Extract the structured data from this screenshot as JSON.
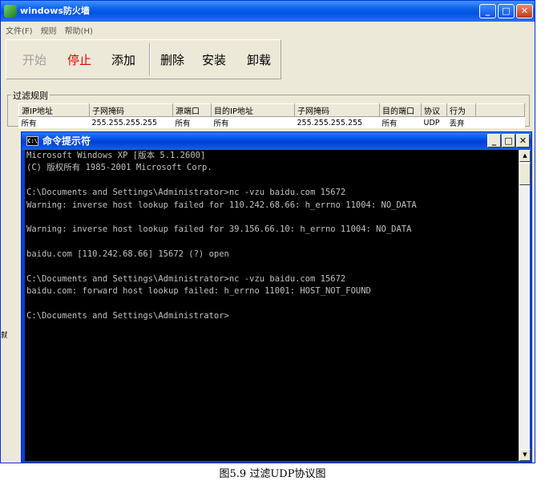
{
  "fw_window": {
    "title": "windows防火墙",
    "menu": [
      "文件(F)",
      "规则",
      "帮助(H)"
    ],
    "toolbar": {
      "start": "开始",
      "stop": "停止",
      "add": "添加",
      "delete": "删除",
      "install": "安装",
      "uninstall": "卸载"
    },
    "rules_group_label": "过滤规则",
    "table": {
      "headers": [
        "源IP地址",
        "子网掩码",
        "源端口",
        "目的IP地址",
        "子网掩码",
        "目的端口",
        "协议",
        "行为"
      ],
      "rows": [
        [
          "所有",
          "255.255.255.255",
          "所有",
          "所有",
          "255.255.255.255",
          "所有",
          "UDP",
          "丢弃"
        ]
      ]
    },
    "status_fragment": "就"
  },
  "cmd_window": {
    "title": "命令提示符",
    "lines": [
      "Microsoft Windows XP [版本 5.1.2600]",
      "(C) 版权所有 1985-2001 Microsoft Corp.",
      "",
      "C:\\Documents and Settings\\Administrator>nc -vzu baidu.com 15672",
      "Warning: inverse host lookup failed for 110.242.68.66: h_errno 11004: NO_DATA",
      "",
      "Warning: inverse host lookup failed for 39.156.66.10: h_errno 11004: NO_DATA",
      "",
      "baidu.com [110.242.68.66] 15672 (?) open",
      "",
      "C:\\Documents and Settings\\Administrator>nc -vzu baidu.com 15672",
      "baidu.com: forward host lookup failed: h_errno 11001: HOST_NOT_FOUND",
      "",
      "C:\\Documents and Settings\\Administrator>"
    ]
  },
  "caption": "图5.9  过滤UDP协议图"
}
